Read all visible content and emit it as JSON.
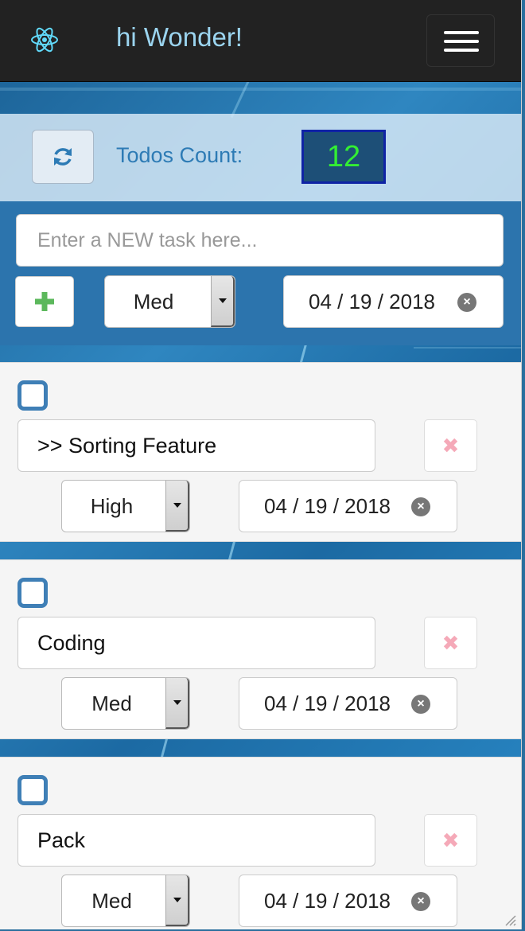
{
  "navbar": {
    "logo_icon": "react-atom-icon",
    "brand": "hi Wonder!",
    "menu_icon": "hamburger-menu-icon"
  },
  "todos_counter": {
    "refresh_icon": "refresh-icon",
    "label": "Todos Count:",
    "count": "12"
  },
  "new_task": {
    "placeholder": "Enter a NEW task here...",
    "value": "",
    "add_icon": "plus-icon",
    "priority": "Med",
    "date": "04 / 19 / 2018",
    "clear_icon": "clear-date-icon"
  },
  "tasks": [
    {
      "done": false,
      "title": ">> Sorting Feature",
      "priority": "High",
      "date": "04 / 19 / 2018"
    },
    {
      "done": false,
      "title": "Coding",
      "priority": "Med",
      "date": "04 / 19 / 2018"
    },
    {
      "done": false,
      "title": "Pack",
      "priority": "Med",
      "date": "04 / 19 / 2018"
    }
  ],
  "colors": {
    "navbar": "#222222",
    "brand": "#9bd4ef",
    "count_text": "#33ee33",
    "checkbox": "#3f7fb6",
    "delete": "#f5a9b8",
    "add": "#5cb85c"
  }
}
